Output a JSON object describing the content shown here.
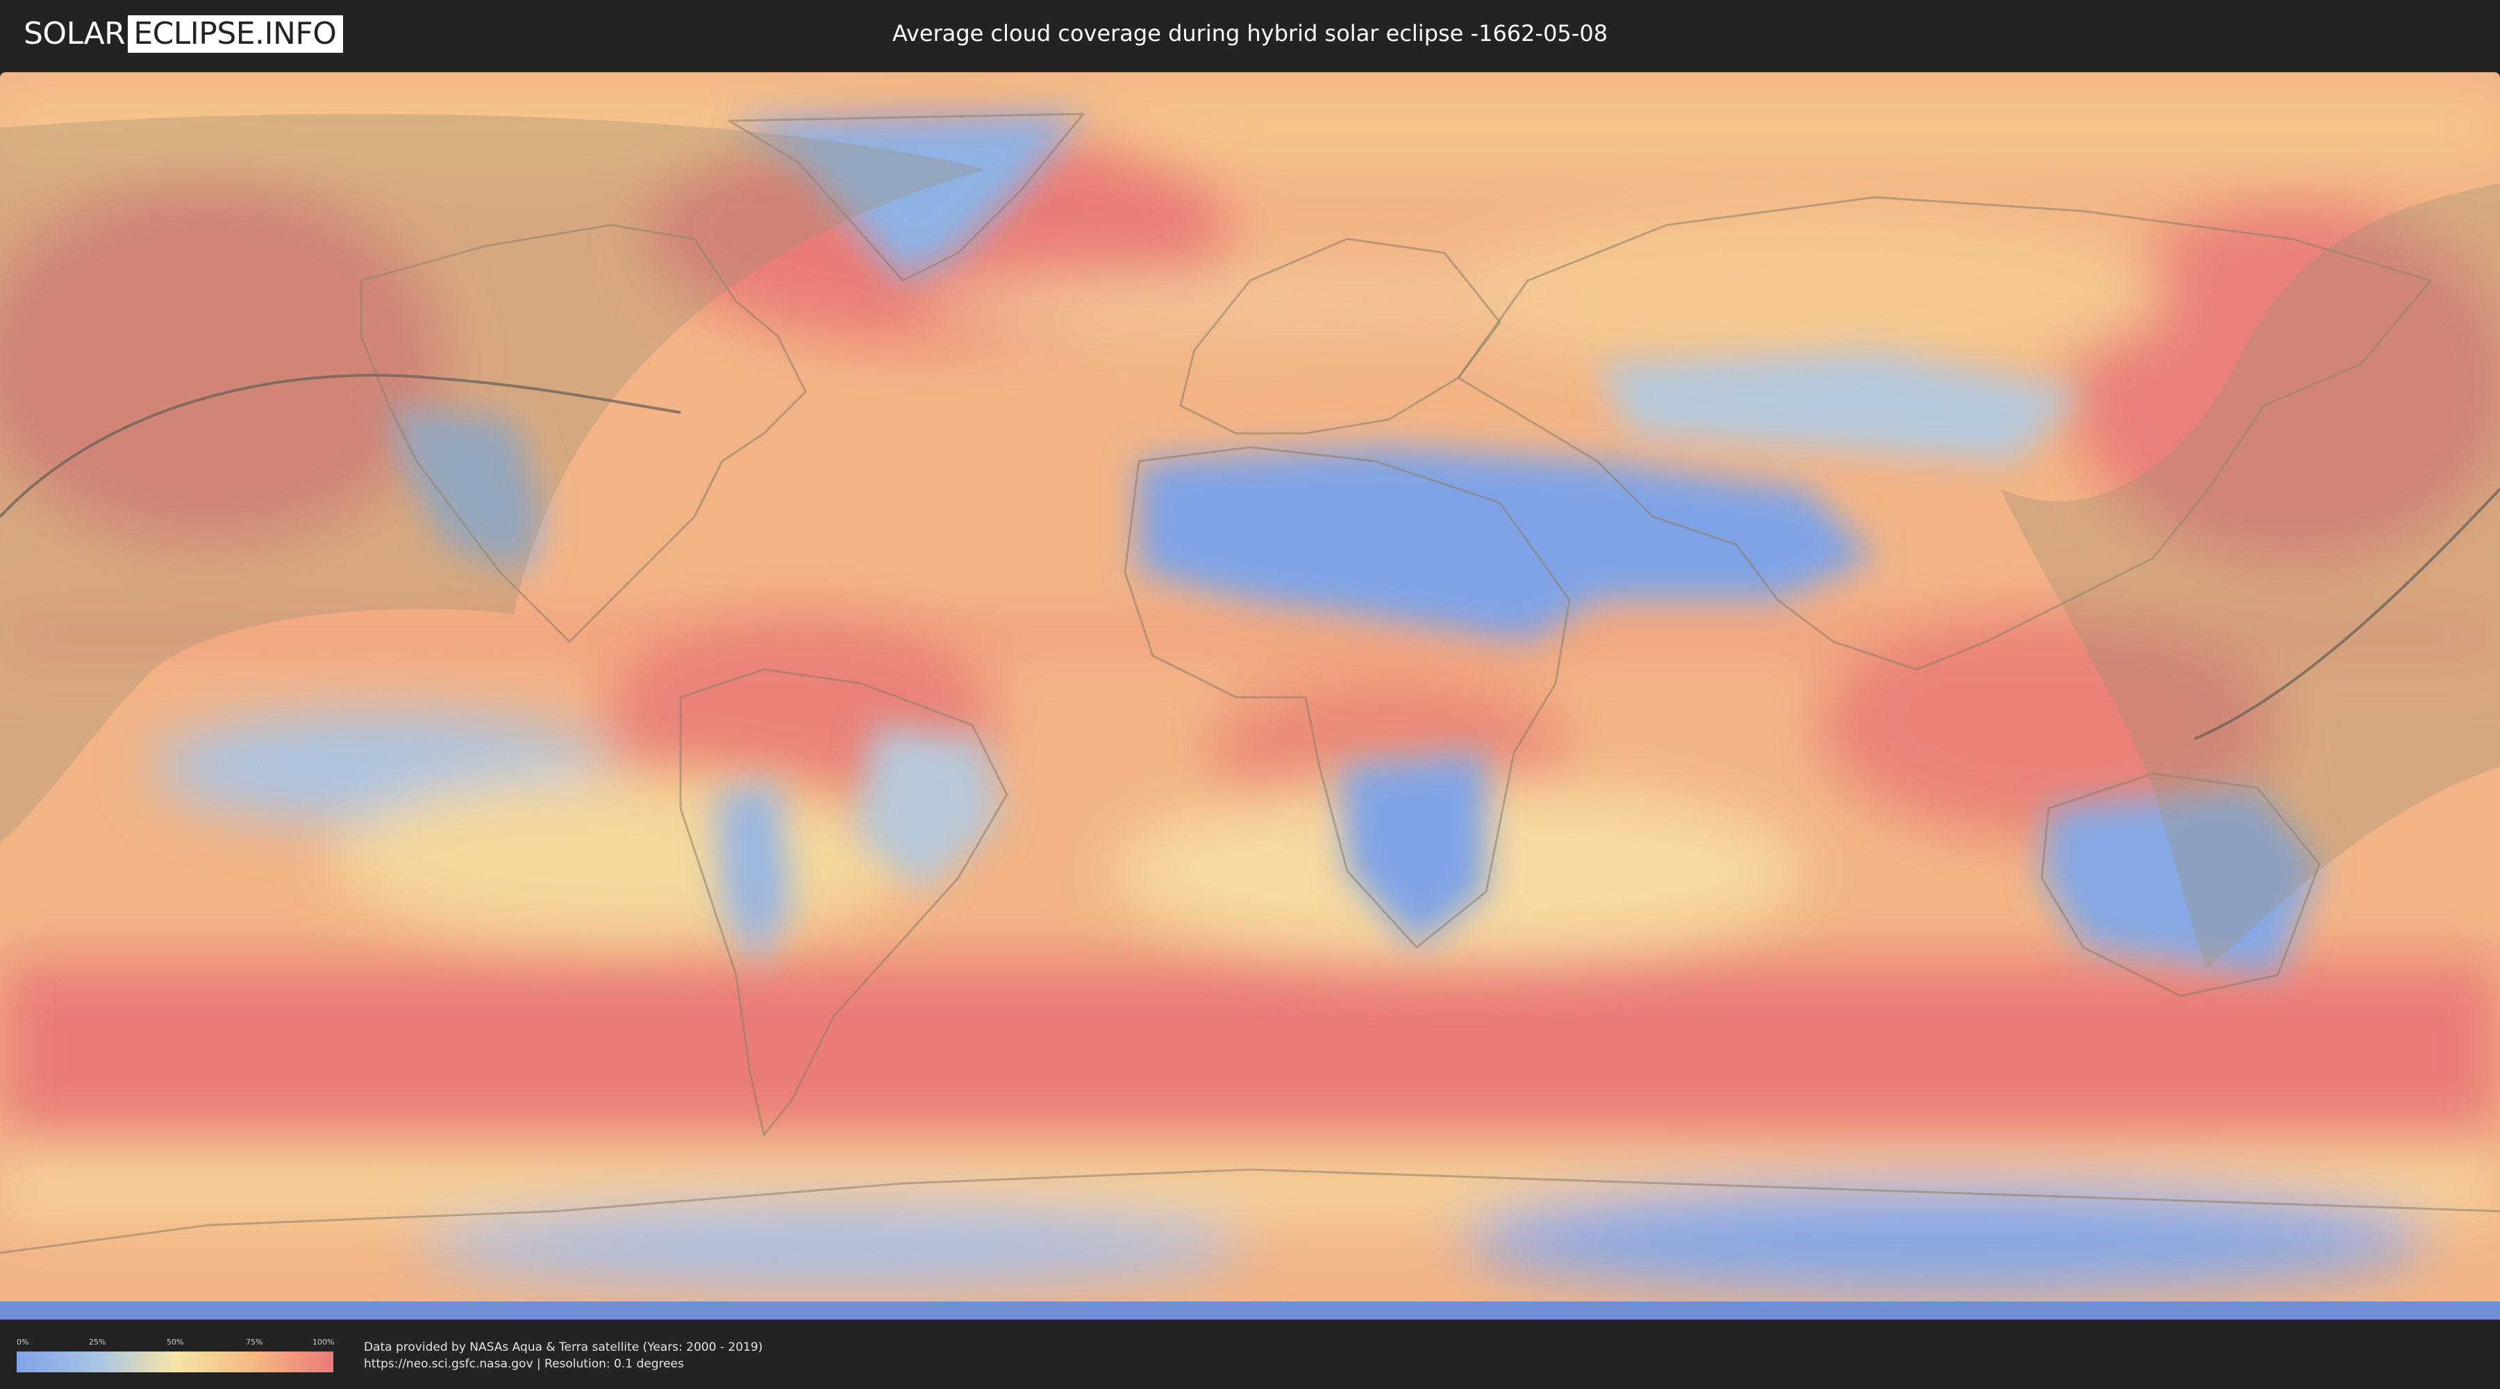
{
  "header": {
    "logo_left": "SOLAR",
    "logo_right": "ECLIPSE.INFO",
    "title": "Average cloud coverage during hybrid solar eclipse -1662-05-08"
  },
  "map": {
    "layer": "cloud coverage",
    "projection": "equirectangular",
    "colors": {
      "clear": "#7fa3e6",
      "low": "#a9c3e4",
      "mid": "#f4e5a8",
      "high": "#f4b882",
      "overcast": "#ea7a7a",
      "eclipse_overlay": "#9a8e74",
      "eclipse_path": "#6a6258"
    }
  },
  "legend": {
    "ticks": [
      "0%",
      "25%",
      "50%",
      "75%",
      "100%"
    ],
    "tick_fractions": [
      0,
      0.25,
      0.5,
      0.75,
      1.0
    ]
  },
  "footer": {
    "credit_line1": "Data provided by NASAs Aqua & Terra satellite (Years: 2000 - 2019)",
    "credit_line2": "https://neo.sci.gsfc.nasa.gov | Resolution: 0.1 degrees"
  }
}
